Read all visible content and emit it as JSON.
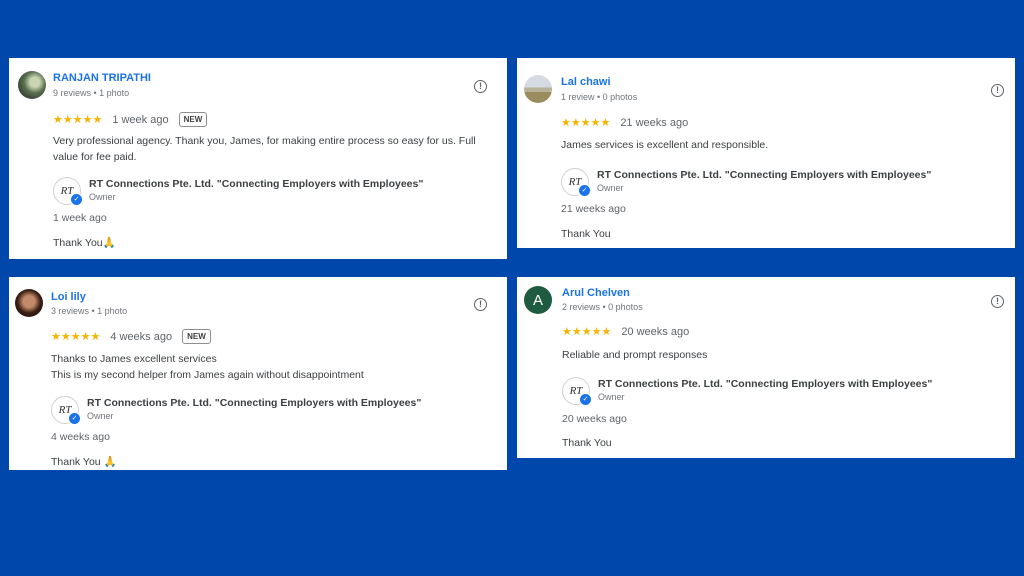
{
  "reviews": [
    {
      "name": "RANJAN TRIPATHI",
      "meta": "9 reviews • 1 photo",
      "avatar": "user-photo-icon",
      "stars": "★★★★★",
      "time": "1 week ago",
      "badge": "NEW",
      "text_lines": [
        "Very professional agency. Thank you, James, for making entire process so easy for us. Full",
        "value for fee paid."
      ],
      "owner_name": "RT Connections Pte. Ltd. \"Connecting Employers with Employees\"",
      "owner_role": "Owner",
      "owner_logo": "RT",
      "reply_time": "1 week ago",
      "reply_text": "Thank You🙏"
    },
    {
      "name": "Lal chawi",
      "meta": "1 review • 0 photos",
      "avatar": "user-photo-icon",
      "stars": "★★★★★",
      "time": "21 weeks ago",
      "badge": "",
      "text_lines": [
        "James services is excellent and responsible."
      ],
      "owner_name": "RT Connections Pte. Ltd. \"Connecting Employers with Employees\"",
      "owner_role": "Owner",
      "owner_logo": "RT",
      "reply_time": "21 weeks ago",
      "reply_text": "Thank You"
    },
    {
      "name": "Loi lily",
      "meta": "3 reviews • 1 photo",
      "avatar": "user-photo-icon",
      "stars": "★★★★★",
      "time": "4 weeks ago",
      "badge": "NEW",
      "text_lines": [
        "Thanks to James excellent services",
        "This is my second helper from James again without disappointment"
      ],
      "owner_name": "RT Connections Pte. Ltd. \"Connecting Employers with Employees\"",
      "owner_role": "Owner",
      "owner_logo": "RT",
      "reply_time": "4 weeks ago",
      "reply_text": "Thank You 🙏"
    },
    {
      "name": "Arul Chelven",
      "meta": "2 reviews • 0 photos",
      "avatar_letter": "A",
      "stars": "★★★★★",
      "time": "20 weeks ago",
      "badge": "",
      "text_lines": [
        "Reliable and prompt responses"
      ],
      "owner_name": "RT Connections Pte. Ltd. \"Connecting Employers with Employees\"",
      "owner_role": "Owner",
      "owner_logo": "RT",
      "reply_time": "20 weeks ago",
      "reply_text": "Thank You"
    }
  ],
  "flag_icon": "!",
  "verified_icon": "✓",
  "colors": {
    "background": "#0047ab",
    "name": "#1a73e8",
    "stars": "#f4b400",
    "avatar_letter_bg": "#1e5b3f"
  }
}
